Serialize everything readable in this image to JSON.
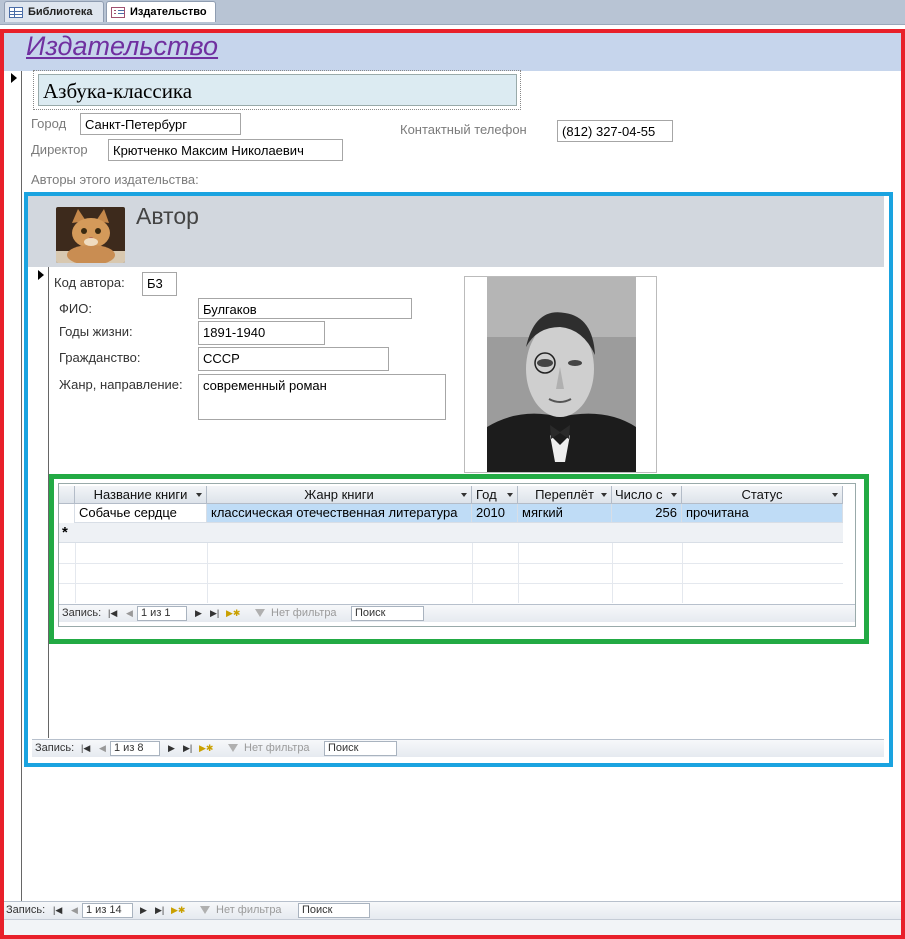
{
  "tabs": [
    {
      "label": "Библиотека",
      "icon": "table-icon",
      "active": false
    },
    {
      "label": "Издательство",
      "icon": "form-icon",
      "active": true
    }
  ],
  "publisher": {
    "header": "Издательство",
    "name": "Азбука-классика",
    "city_label": "Город",
    "city": "Санкт-Петербург",
    "director_label": "Директор",
    "director": "Крютченко Максим Николаевич",
    "phone_label": "Контактный телефон",
    "phone": "(812) 327-04-55",
    "authors_label": "Авторы этого издательства:"
  },
  "author": {
    "header": "Автор",
    "code_label": "Код автора:",
    "code": "Б3",
    "fio_label": "ФИО:",
    "fio": "Булгаков",
    "years_label": "Годы жизни:",
    "years": "1891-1940",
    "citizenship_label": "Гражданство:",
    "citizenship": "СССР",
    "genre_label": "Жанр, направление:",
    "genre": "современный роман"
  },
  "books": {
    "columns": [
      "Название книги",
      "Жанр книги",
      "Год",
      "Переплёт",
      "Число с",
      "Статус"
    ],
    "rows": [
      [
        "Собачье сердце",
        "классическая отечественная литература",
        "2010",
        "мягкий",
        "256",
        "прочитана"
      ]
    ],
    "new_row_marker": "*",
    "nav": {
      "record_label": "Запись:",
      "position": "1 из 1",
      "filter": "Нет фильтра",
      "search": "Поиск"
    }
  },
  "author_nav": {
    "record_label": "Запись:",
    "position": "1 из 8",
    "filter": "Нет фильтра",
    "search": "Поиск"
  },
  "publisher_nav": {
    "record_label": "Запись:",
    "position": "1 из 14",
    "filter": "Нет фильтра",
    "search": "Поиск"
  },
  "colors": {
    "annotation_red": "#e8202a",
    "annotation_blue": "#1aa3e0",
    "annotation_green": "#22aa44",
    "header_accent": "#7030a0"
  }
}
